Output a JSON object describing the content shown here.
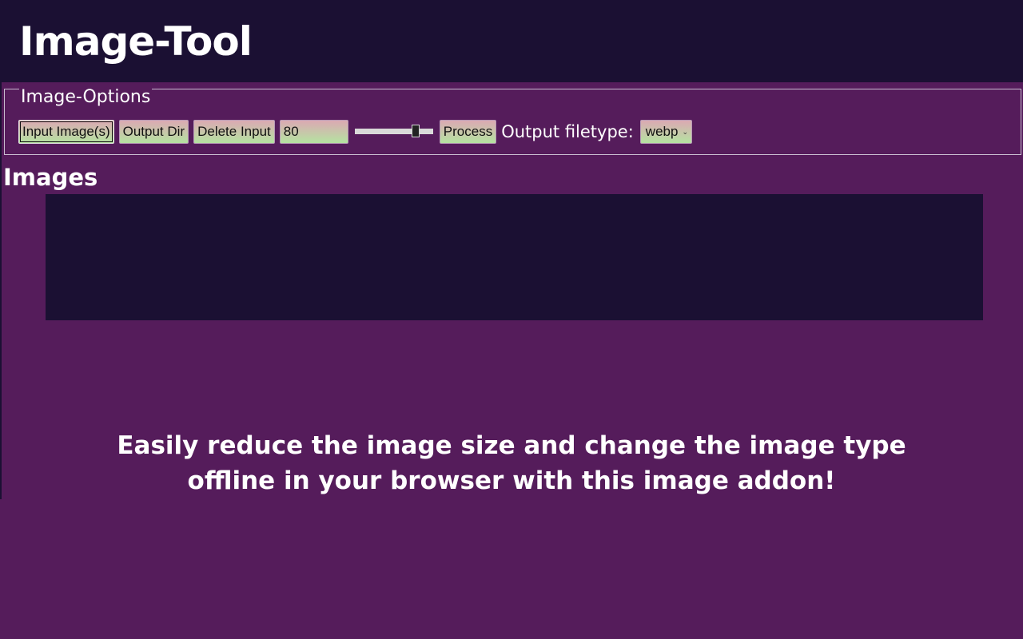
{
  "app": {
    "title": "Image-Tool"
  },
  "options": {
    "legend": "Image-Options",
    "input_images_label": "Input Image(s)",
    "output_dir_label": "Output Dir",
    "delete_input_label": "Delete Input",
    "quality_value": "80",
    "quality_slider_value": 80,
    "process_label": "Process",
    "filetype_label": "Output filetype:",
    "filetype_selected": "webp"
  },
  "images": {
    "heading": "Images"
  },
  "tagline": {
    "line1": "Easily reduce the image size and change the image type",
    "line2": "offline in your browser with this image addon!"
  },
  "colors": {
    "background": "#551c5b",
    "header": "#1b1033",
    "button_gradient_top": "#dba9b3",
    "button_gradient_bottom": "#b5e3a1"
  }
}
